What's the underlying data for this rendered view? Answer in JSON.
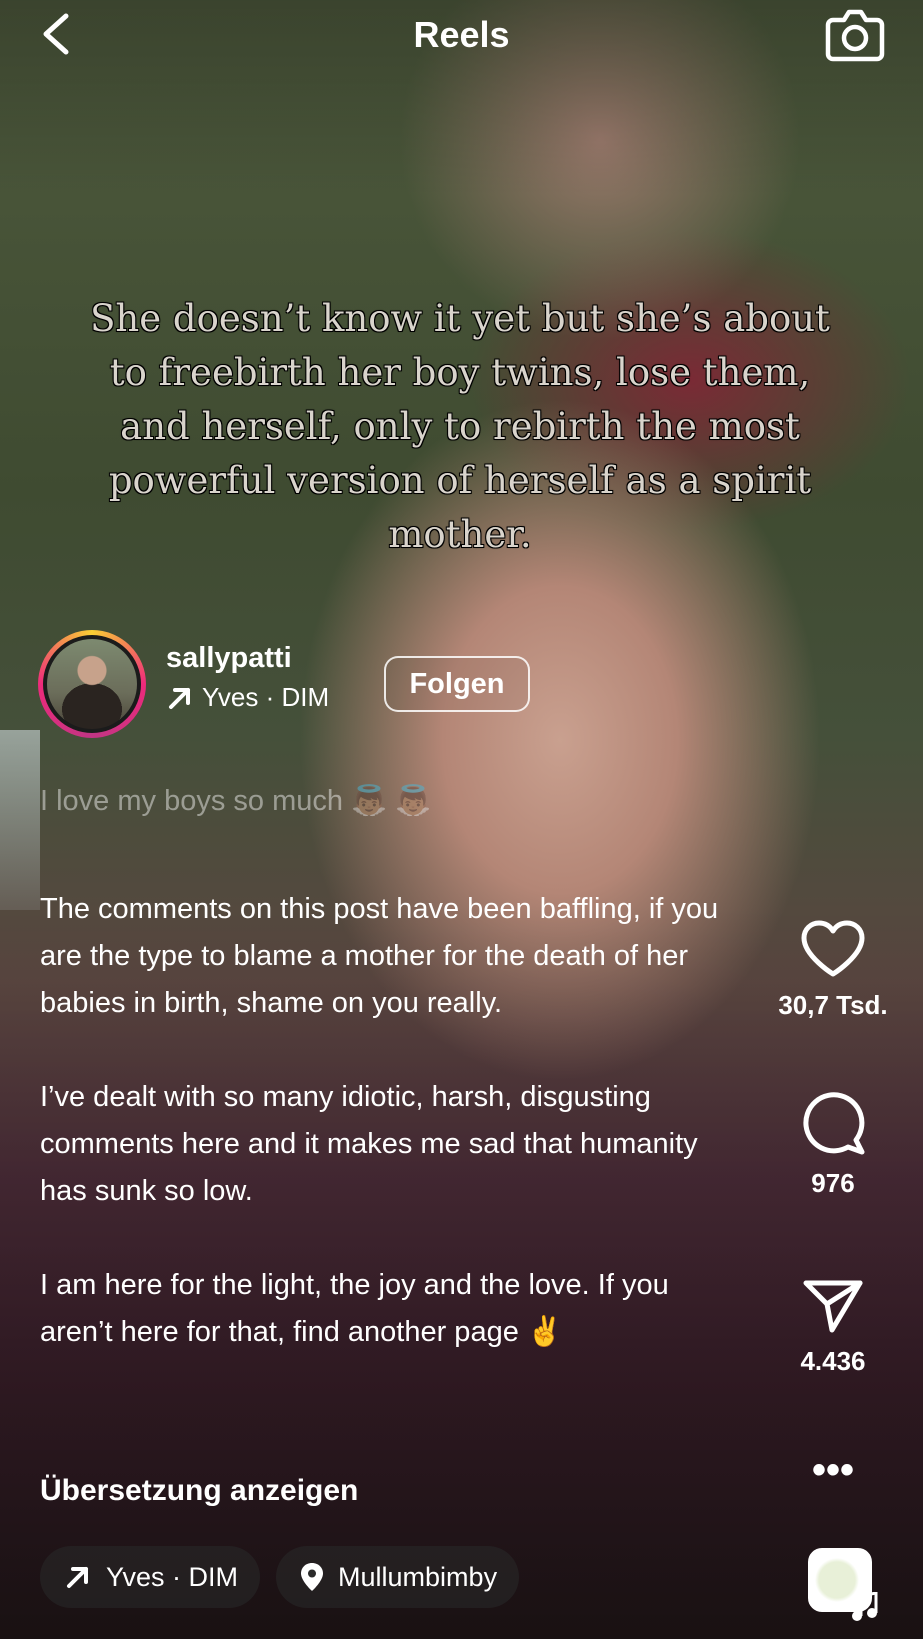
{
  "header": {
    "title": "Reels"
  },
  "overlay_text": "She doesn’t know it yet but she’s about to freebirth her boy twins, lose them, and herself, only to rebirth the most powerful version of herself as a spirit mother.",
  "author": {
    "username": "sallypatti",
    "audio_label": "Yves · DIM",
    "follow_label": "Folgen"
  },
  "caption_faded_line": "I love my boys so much 👼🏽 👼🏽",
  "caption": "The comments on this post have been baffling, if you are the type to blame a mother for the death of her babies in birth, shame on you really.\n\nI’ve dealt with so many idiotic, harsh, disgusting comments here and it makes me sad that humanity has sunk so low.\n\nI am here for the light, the joy and the love. If you aren’t here for that, find another page ✌️",
  "translate_label": "Übersetzung anzeigen",
  "chips": {
    "audio": "Yves · DIM",
    "location": "Mullumbimby"
  },
  "actions": {
    "likes": "30,7 Tsd.",
    "comments": "976",
    "shares": "4.436",
    "more": "•••"
  },
  "icons": {
    "back": "chevron-left-icon",
    "camera": "camera-icon",
    "like": "heart-icon",
    "comment": "comment-bubble-icon",
    "share": "paper-plane-icon",
    "audio": "arrow-up-right-icon",
    "location": "map-pin-icon",
    "music": "music-note-icon"
  }
}
